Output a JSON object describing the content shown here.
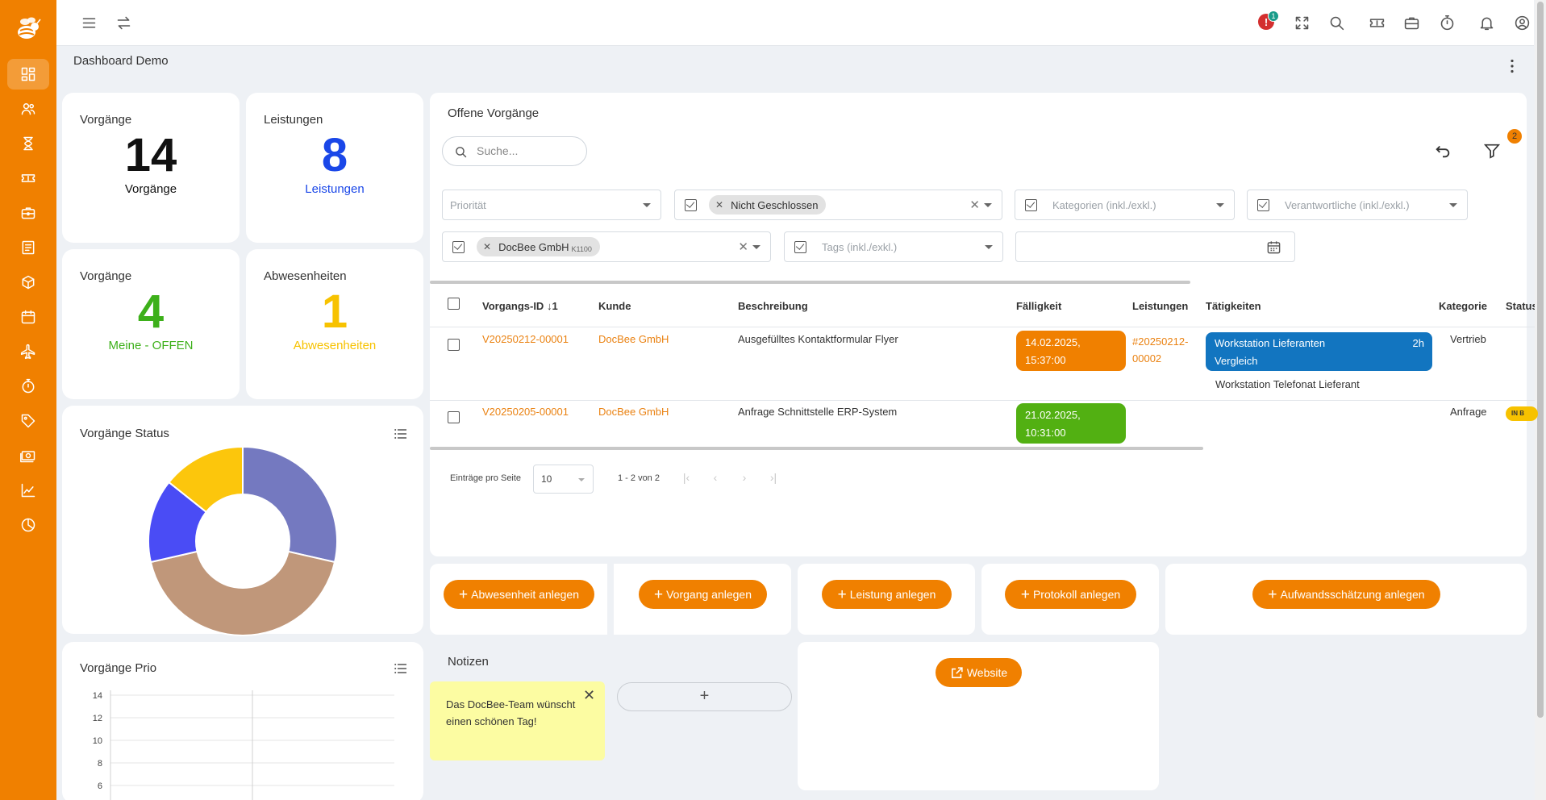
{
  "colors": {
    "brand": "#f08000",
    "link": "#ea8212",
    "blue": "#1a47e8",
    "green": "#3db01a",
    "yellow": "#f7c200",
    "task_blue": "#1275c0",
    "due_orange": "#f08000",
    "due_green": "#52b012"
  },
  "icons": {
    "sidebar": [
      "dashboard-icon",
      "users-icon",
      "hourglass-icon",
      "ticket-icon",
      "briefcase-icon",
      "document-icon",
      "box-icon",
      "calendar-icon",
      "plane-icon",
      "stopwatch-icon",
      "tag-icon",
      "money-icon",
      "chart-line-icon",
      "pie-chart-icon"
    ],
    "topbar": [
      "menu-icon",
      "swap-icon",
      "alert-icon",
      "fullscreen-icon",
      "search-icon",
      "ticket-icon",
      "briefcase-icon",
      "stopwatch-icon",
      "bell-icon",
      "account-icon",
      "more-vertical-icon"
    ]
  },
  "topbar": {
    "alert_count": "1",
    "alert_symbol": "!"
  },
  "page": {
    "title": "Dashboard Demo"
  },
  "stats": [
    {
      "title": "Vorgänge",
      "value": "14",
      "label": "Vorgänge",
      "color": "#111111"
    },
    {
      "title": "Leistungen",
      "value": "8",
      "label": "Leistungen",
      "color": "#1a47e8"
    },
    {
      "title": "Vorgänge",
      "value": "4",
      "label": "Meine - OFFEN",
      "color": "#3db01a"
    },
    {
      "title": "Abwesenheiten",
      "value": "1",
      "label": "Abwesenheiten",
      "color": "#f7c200"
    }
  ],
  "status_chart": {
    "title": "Vorgänge Status",
    "chart_data": {
      "type": "pie",
      "variant": "donut",
      "values": [
        4,
        6,
        2,
        2
      ],
      "colors": [
        "#7479c0",
        "#c0977a",
        "#4a4cf5",
        "#fcc60c"
      ],
      "legend": "hidden"
    }
  },
  "prio_chart": {
    "title": "Vorgänge Prio",
    "chart_data": {
      "type": "bar",
      "y_ticks": [
        "14",
        "12",
        "10",
        "8",
        "6"
      ],
      "ylim": [
        0,
        14
      ],
      "grid": true
    }
  },
  "open_tasks": {
    "title": "Offene Vorgänge",
    "search_placeholder": "Suche...",
    "filter_badge": "2",
    "filters": {
      "priority": "Priorität",
      "status_chip": "Nicht Geschlossen",
      "categories": "Kategorien (inkl./exkl.)",
      "responsible": "Verantwortliche (inkl./exkl.)",
      "customer_chip": "DocBee GmbH",
      "customer_chip_sub": "K1100",
      "tags": "Tags (inkl./exkl.)"
    },
    "columns": [
      "Vorgangs-ID",
      "Kunde",
      "Beschreibung",
      "Fälligkeit",
      "Leistungen",
      "Tätigkeiten",
      "Kategorie",
      "Status"
    ],
    "sort_indicator": "↓1",
    "rows": [
      {
        "id": "V20250212-00001",
        "customer": "DocBee GmbH",
        "description": "Ausgefülltes Kontaktformular Flyer",
        "due_date": "14.02.2025,",
        "due_time": "15:37:00",
        "service_a": "#20250212-",
        "service_b": "00002",
        "task_a": "Workstation Lieferanten",
        "task_b": "Vergleich",
        "task_duration": "2h",
        "task_second": "Workstation Telefonat Lieferant",
        "category": "Vertrieb",
        "status": ""
      },
      {
        "id": "V20250205-00001",
        "customer": "DocBee GmbH",
        "description": "Anfrage Schnittstelle ERP-System",
        "due_date": "21.02.2025,",
        "due_time": "10:31:00",
        "category": "Anfrage",
        "status": "IN B"
      }
    ],
    "pager": {
      "label": "Einträge pro Seite",
      "page_size": "10",
      "range": "1 - 2 von 2"
    }
  },
  "actions": {
    "absence": "Abwesenheit anlegen",
    "task": "Vorgang anlegen",
    "service": "Leistung anlegen",
    "protocol": "Protokoll anlegen",
    "estimate": "Aufwandsschätzung anlegen"
  },
  "notes": {
    "title": "Notizen",
    "text_a": "Das DocBee-Team wünscht",
    "text_b": "einen schönen Tag!",
    "add": "+"
  },
  "website": {
    "label": "Website"
  }
}
